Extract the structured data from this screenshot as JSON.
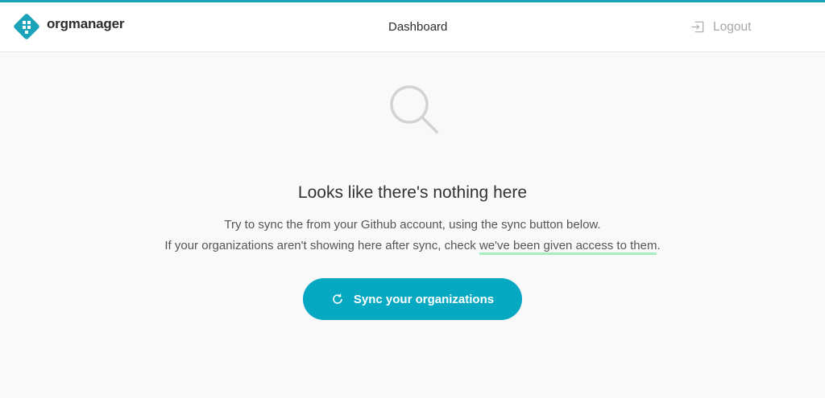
{
  "header": {
    "brand": "orgmanager",
    "nav": {
      "dashboard": "Dashboard"
    },
    "logout": "Logout"
  },
  "empty_state": {
    "icon": "search-icon",
    "title": "Looks like there's nothing here",
    "line1": "Try to sync the from your Github account, using the sync button below.",
    "line2_prefix": "If your organizations aren't showing here after sync, check ",
    "line2_link": "we've been given access to them",
    "line2_suffix": ".",
    "sync_button": "Sync your organizations"
  },
  "colors": {
    "accent": "#07a8c1",
    "link_underline": "#a8ecc0",
    "background": "#f8f9f8"
  }
}
